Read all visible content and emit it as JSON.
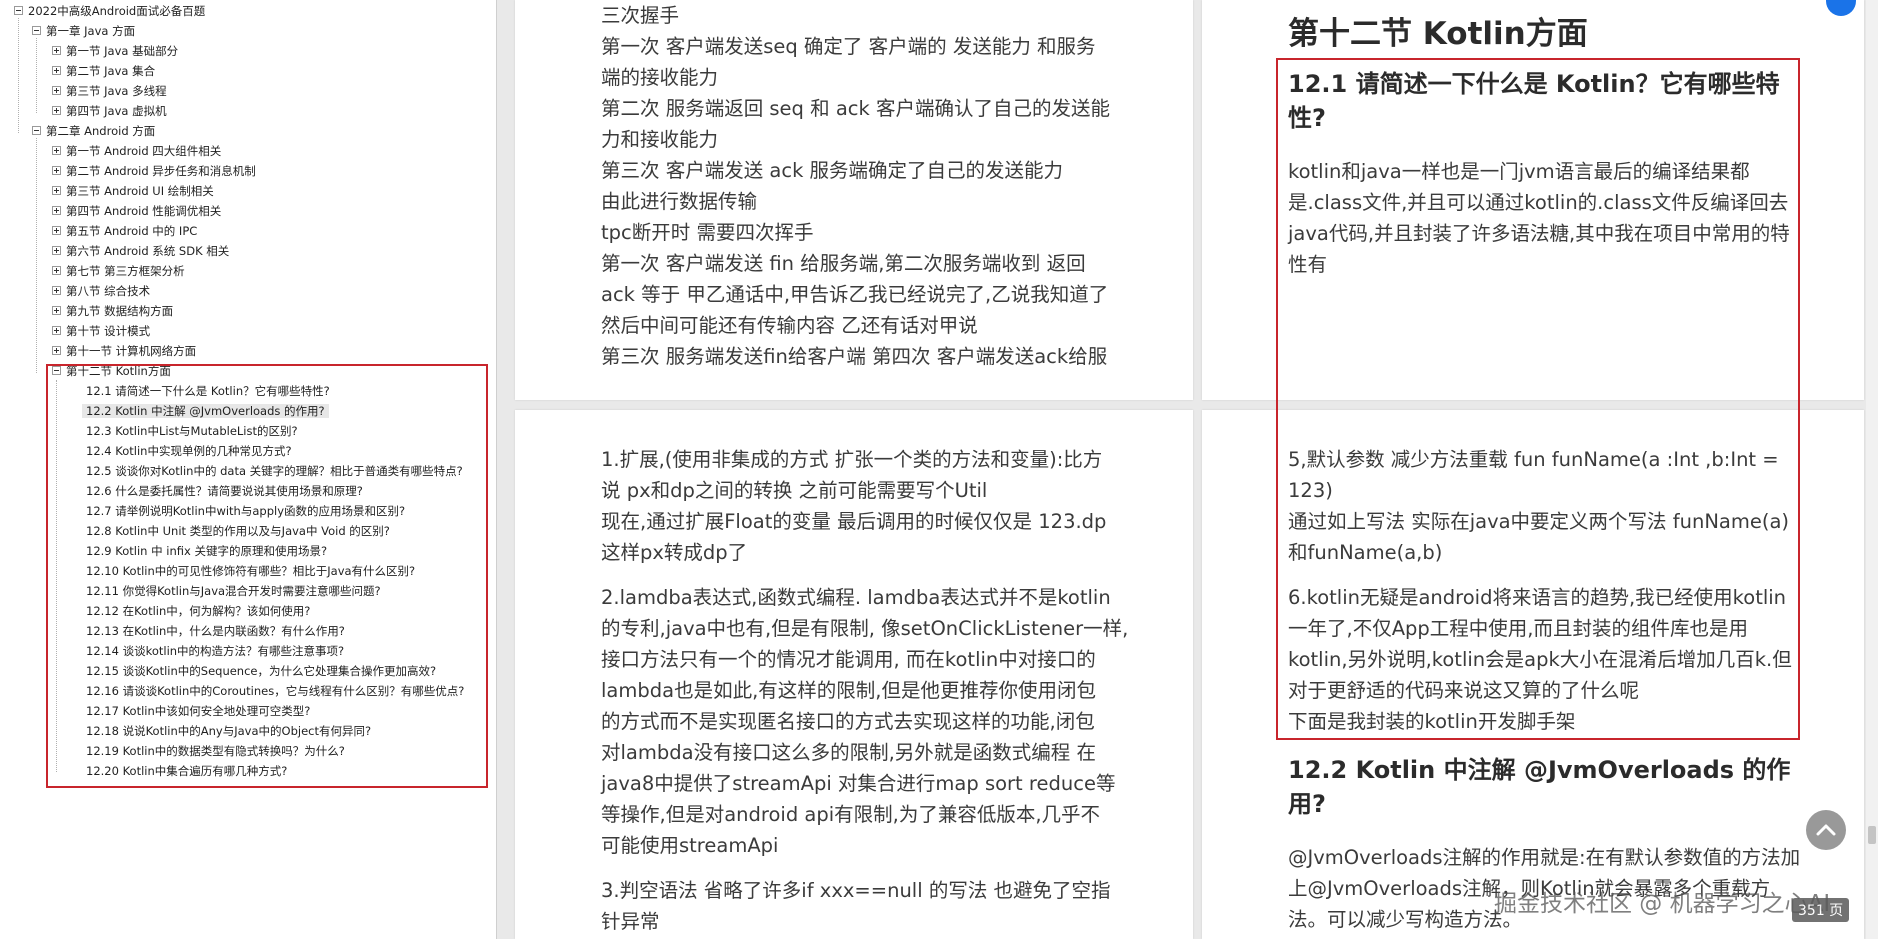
{
  "outline": {
    "root": "2022中高级Android面试必备百题",
    "chapter1": "第一章 Java 方面",
    "ch1_sections": [
      "第一节 Java 基础部分",
      "第二节 Java 集合",
      "第三节 Java 多线程",
      "第四节 Java 虚拟机"
    ],
    "chapter2": "第二章 Android 方面",
    "ch2_sections": [
      "第一节 Android 四大组件相关",
      "第二节 Android 异步任务和消息机制",
      "第三节 Android UI 绘制相关",
      "第四节 Android 性能调优相关",
      "第五节 Android 中的 IPC",
      "第六节 Android 系统 SDK 相关",
      "第七节 第三方框架分析",
      "第八节 综合技术",
      "第九节 数据结构方面",
      "第十节 设计模式",
      "第十一节 计算机网络方面"
    ],
    "kotlin_section": "第十二节 Kotlin方面",
    "kotlin_items": [
      "12.1 请简述一下什么是 Kotlin？它有哪些特性?",
      "12.2 Kotlin 中注解 @JvmOverloads 的作用?",
      "12.3 Kotlin中List与MutableList的区别?",
      "12.4 Kotlin中实现单例的几种常见方式?",
      "12.5 谈谈你对Kotlin中的 data 关键字的理解？相比于普通类有哪些特点?",
      "12.6 什么是委托属性？请简要说说其使用场景和原理?",
      "12.7 请举例说明Kotlin中with与apply函数的应用场景和区别?",
      "12.8 Kotlin中 Unit 类型的作用以及与Java中 Void 的区别?",
      "12.9 Kotlin 中 infix 关键字的原理和使用场景?",
      "12.10 Kotlin中的可见性修饰符有哪些？相比于Java有什么区别?",
      "12.11 你觉得Kotlin与Java混合开发时需要注意哪些问题?",
      "12.12 在Kotlin中，何为解构？该如何使用?",
      "12.13 在Kotlin中，什么是内联函数？有什么作用?",
      "12.14 谈谈kotlin中的构造方法？有哪些注意事项?",
      "12.15 谈谈Kotlin中的Sequence，为什么它处理集合操作更加高效?",
      "12.16 请谈谈Kotlin中的Coroutines，它与线程有什么区别？有哪些优点?",
      "12.17 Kotlin中该如何安全地处理可空类型?",
      "12.18 说说Kotlin中的Any与Java中的Object有何异同?",
      "12.19 Kotlin中的数据类型有隐式转换吗？为什么?",
      "12.20 Kotlin中集合遍历有哪几种方式?"
    ],
    "selected_index": 1
  },
  "card_top_left": {
    "lines": [
      "三次握手",
      "第一次 客户端发送seq 确定了 客户端的 发送能力 和服务",
      "端的接收能力",
      "第二次 服务端返回 seq 和 ack 客户端确认了自己的发送能",
      "力和接收能力",
      "第三次 客户端发送 ack 服务端确定了自己的发送能力",
      "由此进行数据传输",
      "tpc断开时 需要四次挥手",
      "第一次 客户端发送 fin 给服务端,第二次服务端收到 返回",
      "ack 等于 甲乙通话中,甲告诉乙我已经说完了,乙说我知道了",
      "然后中间可能还有传输内容 乙还有话对甲说",
      "第三次 服务端发送fin给客户端 第四次 客户端发送ack给服"
    ]
  },
  "card_top_right": {
    "section_title": "第十二节 Kotlin方面",
    "q1_title_l1": "12.1 请简述一下什么是 Kotlin？它有哪些特",
    "q1_title_l2": "性?",
    "q1_body": [
      "kotlin和java一样也是一门jvm语言最后的编译结果都",
      "是.class文件,并且可以通过kotlin的.class文件反编译回去",
      "java代码,并且封装了许多语法糖,其中我在项目中常用的特",
      "性有"
    ]
  },
  "card_bottom_left": {
    "p1": [
      "1.扩展,(使用非集成的方式 扩张一个类的方法和变量):比方",
      "说 px和dp之间的转换 之前可能需要写个Util",
      "现在,通过扩展Float的变量 最后调用的时候仅仅是 123.dp",
      "这样px转成dp了"
    ],
    "p2": [
      "2.lamdba表达式,函数式编程. lamdba表达式并不是kotlin",
      "的专利,java中也有,但是有限制, 像setOnClickListener一样,",
      "接口方法只有一个的情况才能调用, 而在kotlin中对接口的",
      "lambda也是如此,有这样的限制,但是他更推荐你使用闭包",
      "的方式而不是实现匿名接口的方式去实现这样的功能,闭包",
      "对lambda没有接口这么多的限制,另外就是函数式编程 在",
      "java8中提供了streamApi 对集合进行map sort reduce等",
      "等操作,但是对android api有限制,为了兼容低版本,几乎不",
      "可能使用streamApi"
    ],
    "p3": [
      "3.判空语法 省略了许多if xxx==null 的写法 也避免了空指",
      "针异常"
    ]
  },
  "card_bottom_right": {
    "p5": [
      "5,默认参数 减少方法重载 fun funName(a :Int ,b:Int =",
      "123)",
      "通过如上写法 实际在java中要定义两个写法 funName(a)",
      "和funName(a,b)"
    ],
    "p6": [
      "6.kotlin无疑是android将来语言的趋势,我已经使用kotlin",
      "一年了,不仅App工程中使用,而且封装的组件库也是用",
      "kotlin,另外说明,kotlin会是apk大小在混淆后增加几百k.但",
      "对于更舒适的代码来说这又算的了什么呢",
      "下面是我封装的kotlin开发脚手架"
    ],
    "q2_title_l1": "12.2 Kotlin 中注解 @JvmOverloads 的作",
    "q2_title_l2": "用?",
    "q2_body": [
      "@JvmOverloads注解的作用就是:在有默认参数值的方法加",
      "上@JvmOverloads注解，则Kotlin就会暴露多个重载方",
      "法。可以减少写构造方法。"
    ]
  },
  "watermark": "掘金技术社区 @ 机器学习之心AI",
  "page_badge": "351 页",
  "colors": {
    "highlight_border": "#c8252c",
    "tree_selected": "#e7e7e7"
  },
  "icons": [
    "expand-toggle-icon",
    "back-to-top-icon"
  ]
}
